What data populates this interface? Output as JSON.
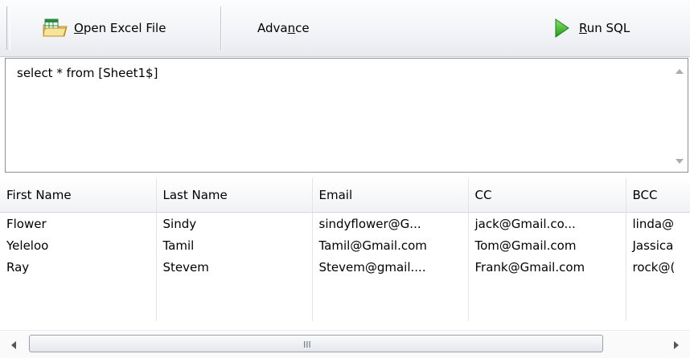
{
  "toolbar": {
    "open_excel_label_pre": "",
    "open_excel_mnemonic": "O",
    "open_excel_label_post": "pen Excel File",
    "advance_label_pre": "Adva",
    "advance_mnemonic": "n",
    "advance_label_post": "ce",
    "run_sql_label_pre": "",
    "run_sql_mnemonic": "R",
    "run_sql_label_post": "un SQL"
  },
  "editor": {
    "query": "select * from [Sheet1$]"
  },
  "grid": {
    "columns": [
      "First Name",
      "Last Name",
      "Email",
      "CC",
      "BCC"
    ],
    "rows": [
      [
        "Flower",
        "Sindy",
        "sindyflower@G...",
        "jack@Gmail.co...",
        "linda@"
      ],
      [
        "Yeleloo",
        "Tamil",
        "Tamil@Gmail.com",
        "Tom@Gmail.com",
        "Jassica"
      ],
      [
        "Ray",
        "Stevem",
        "Stevem@gmail....",
        "Frank@Gmail.com",
        "rock@("
      ],
      [
        "",
        "",
        "",
        "",
        ""
      ],
      [
        "",
        "",
        "",
        "",
        ""
      ]
    ]
  },
  "scrollbar": {
    "grip_text": "III"
  },
  "colors": {
    "run_icon": "#2fb52a",
    "excel_icon": "#2a8a3a"
  }
}
